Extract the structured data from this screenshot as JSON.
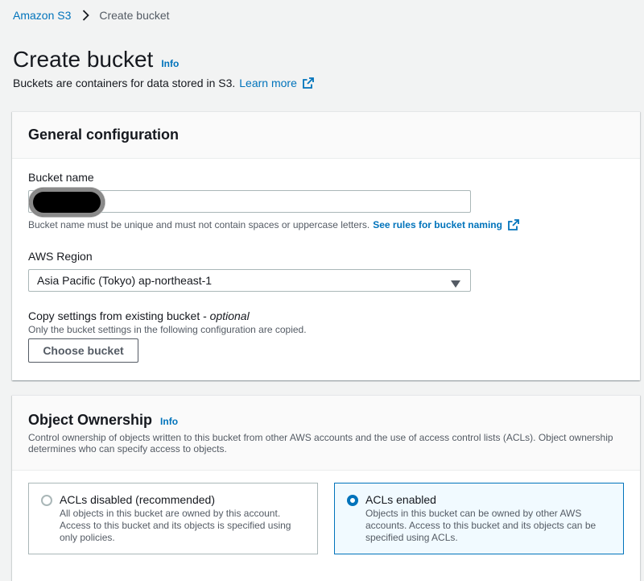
{
  "breadcrumb": {
    "service": "Amazon S3",
    "current": "Create bucket"
  },
  "page": {
    "title": "Create bucket",
    "info": "Info",
    "description": "Buckets are containers for data stored in S3.",
    "learn_more": "Learn more"
  },
  "general": {
    "title": "General configuration",
    "bucket_name_label": "Bucket name",
    "bucket_name_hint": "Bucket name must be unique and must not contain spaces or uppercase letters.",
    "bucket_rules_link": "See rules for bucket naming",
    "region_label": "AWS Region",
    "region_value": "Asia Pacific (Tokyo) ap-northeast-1",
    "copy_label": "Copy settings from existing bucket - ",
    "copy_optional": "optional",
    "copy_hint": "Only the bucket settings in the following configuration are copied.",
    "choose_button": "Choose bucket"
  },
  "ownership": {
    "title": "Object Ownership",
    "info": "Info",
    "description": "Control ownership of objects written to this bucket from other AWS accounts and the use of access control lists (ACLs). Object ownership determines who can specify access to objects.",
    "options": [
      {
        "title": "ACLs disabled (recommended)",
        "description": "All objects in this bucket are owned by this account. Access to this bucket and its objects is specified using only policies.",
        "selected": false
      },
      {
        "title": "ACLs enabled",
        "description": "Objects in this bucket can be owned by other AWS accounts. Access to this bucket and its objects can be specified using ACLs.",
        "selected": true
      }
    ]
  },
  "colors": {
    "link": "#0073bb",
    "text": "#16191f",
    "secondary_text": "#545b64",
    "page_bg": "#f2f3f3",
    "selected_tile_bg": "#f1faff"
  },
  "icons": {
    "breadcrumb_separator": "chevron-right-icon",
    "external": "external-link-icon",
    "select_caret": "caret-down-icon"
  }
}
